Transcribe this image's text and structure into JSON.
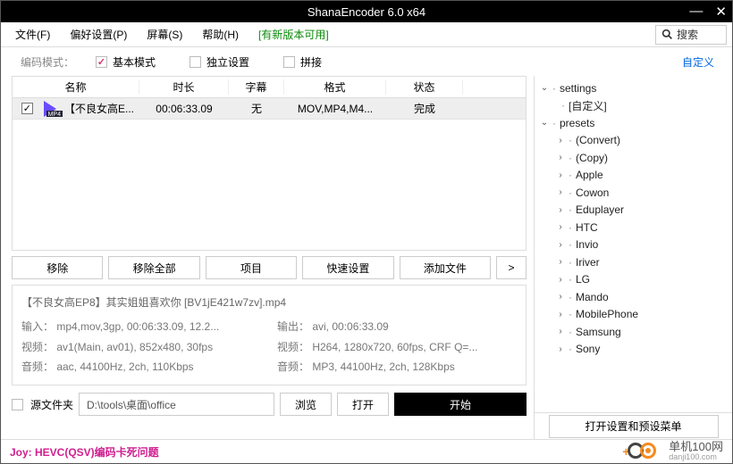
{
  "title": "ShanaEncoder 6.0 x64",
  "menu": {
    "file": "文件(F)",
    "pref": "偏好设置(P)",
    "screen": "屏幕(S)",
    "help": "帮助(H)",
    "update": "[有新版本可用]"
  },
  "search": {
    "placeholder": "搜索"
  },
  "toolbar": {
    "modeLabel": "编码模式：",
    "basic": "基本模式",
    "individual": "独立设置",
    "concat": "拼接",
    "custom": "自定义"
  },
  "table": {
    "headers": {
      "name": "名称",
      "duration": "时长",
      "subtitle": "字幕",
      "format": "格式",
      "status": "状态"
    },
    "row": {
      "name": "【不良女高E...",
      "duration": "00:06:33.09",
      "subtitle": "无",
      "format": "MOV,MP4,M4...",
      "status": "完成",
      "icon_tag": "MP4"
    }
  },
  "buttons": {
    "remove": "移除",
    "removeAll": "移除全部",
    "project": "项目",
    "quick": "快速设置",
    "add": "添加文件",
    "more": ">"
  },
  "info": {
    "filename": "【不良女高EP8】其实姐姐喜欢你 [BV1jE421w7zv].mp4",
    "in1": "输入： mp4,mov,3gp, 00:06:33.09, 12.2...",
    "in2": "视频： av1(Main, av01), 852x480, 30fps",
    "in3": "音频： aac, 44100Hz, 2ch, 110Kbps",
    "out1": "输出： avi, 00:06:33.09",
    "out2": "视频： H264, 1280x720, 60fps, CRF Q=...",
    "out3": "音频： MP3, 44100Hz, 2ch, 128Kbps"
  },
  "bottom": {
    "sourceFolder": "源文件夹",
    "path": "D:\\tools\\桌面\\office",
    "browse": "浏览",
    "open": "打开",
    "start": "开始"
  },
  "tree": {
    "settings": "settings",
    "custom": "[自定义]",
    "presets": "presets",
    "items": [
      "(Convert)",
      "(Copy)",
      "Apple",
      "Cowon",
      "Eduplayer",
      "HTC",
      "Invio",
      "Iriver",
      "LG",
      "Mando",
      "MobilePhone",
      "Samsung",
      "Sony"
    ],
    "footerBtn": "打开设置和预设菜单"
  },
  "footer": {
    "joy": "Joy: HEVC(QSV)编码卡死问题",
    "brand": "单机100网",
    "brand_url": "danji100.com"
  }
}
